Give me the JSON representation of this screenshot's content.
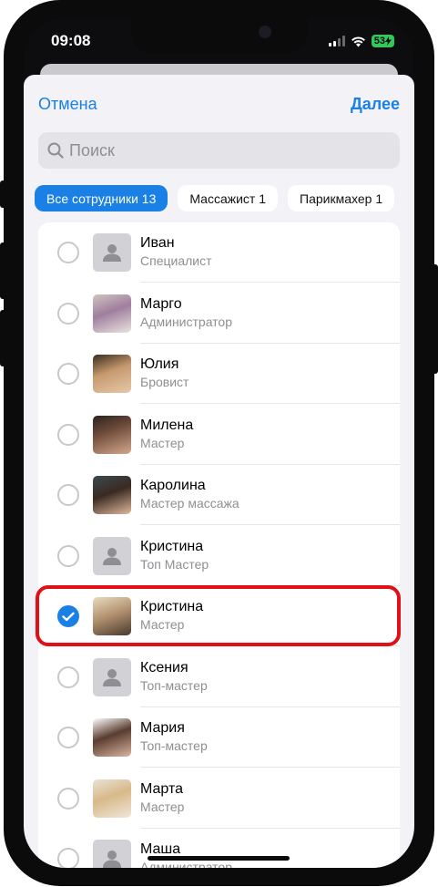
{
  "status_bar": {
    "time": "09:08",
    "battery": "53"
  },
  "nav": {
    "cancel_label": "Отмена",
    "next_label": "Далее"
  },
  "search": {
    "placeholder": "Поиск"
  },
  "filters": [
    {
      "label": "Все сотрудники 13",
      "active": true
    },
    {
      "label": "Массажист 1",
      "active": false
    },
    {
      "label": "Парикмахер 1",
      "active": false
    }
  ],
  "staff": [
    {
      "name": "Иван",
      "role": "Специалист",
      "photo": false,
      "selected": false
    },
    {
      "name": "Марго",
      "role": "Администратор",
      "photo": true,
      "selected": false
    },
    {
      "name": "Юлия",
      "role": "Бровист",
      "photo": true,
      "selected": false
    },
    {
      "name": "Милена",
      "role": "Мастер",
      "photo": true,
      "selected": false
    },
    {
      "name": "Каролина",
      "role": "Мастер массажа",
      "photo": true,
      "selected": false
    },
    {
      "name": "Кристина",
      "role": "Топ Мастер",
      "photo": false,
      "selected": false
    },
    {
      "name": "Кристина",
      "role": "Мастер",
      "photo": true,
      "selected": true
    },
    {
      "name": "Ксения",
      "role": "Топ-мастер",
      "photo": false,
      "selected": false
    },
    {
      "name": "Мария",
      "role": "Топ-мастер",
      "photo": true,
      "selected": false
    },
    {
      "name": "Марта",
      "role": "Мастер",
      "photo": true,
      "selected": false
    },
    {
      "name": "Маша",
      "role": "Администратор",
      "photo": false,
      "selected": false
    }
  ],
  "colors": {
    "accent": "#1a80e6",
    "highlight": "#e10f16",
    "background": "#f2f2f7"
  }
}
